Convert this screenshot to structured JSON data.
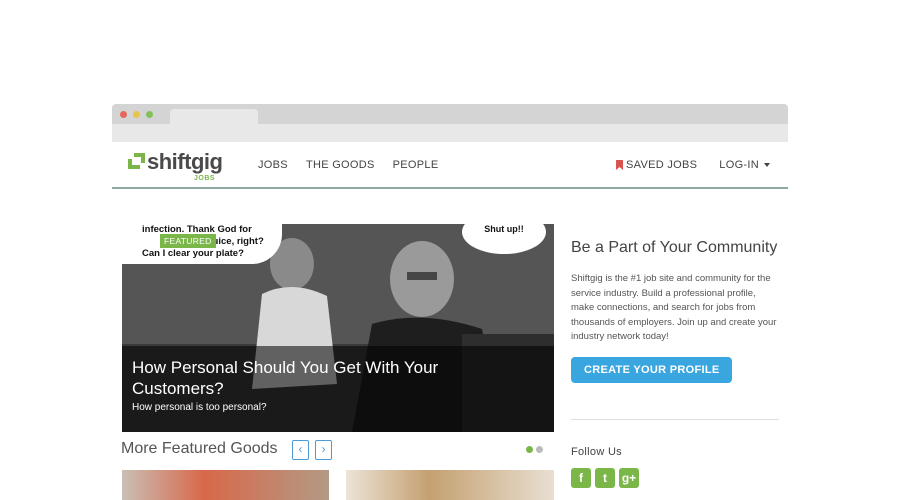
{
  "brand": {
    "name": "shiftgig",
    "subtitle": "JOBS",
    "tm": "™"
  },
  "nav": {
    "items": [
      "JOBS",
      "THE GOODS",
      "PEOPLE"
    ]
  },
  "right_nav": {
    "saved_jobs": "SAVED JOBS",
    "login": "LOG-IN"
  },
  "feature": {
    "badge": "FEATURED",
    "bubble_left": [
      "infection. Thank God for",
      "y juice, right?",
      "Can I clear your plate?"
    ],
    "bubble_right": "Shut up!!",
    "title": "How Personal Should You Get With Your Customers?",
    "subtitle": "How personal is too personal?"
  },
  "more_featured": {
    "title": "More Featured Goods",
    "prev": "‹",
    "next": "›"
  },
  "sidebar": {
    "title": "Be a Part of Your Community",
    "text": "Shiftgig is the #1 job site and community for the service industry. Build a professional profile, make connections, and search for jobs from thousands of employers. Join up and create your industry network today!",
    "cta": "CREATE YOUR PROFILE",
    "follow": "Follow Us",
    "social": [
      {
        "name": "facebook-icon",
        "glyph": "f"
      },
      {
        "name": "twitter-icon",
        "glyph": "t"
      },
      {
        "name": "google-plus-icon",
        "glyph": "g+"
      }
    ]
  },
  "colors": {
    "brand_green": "#7ab648",
    "cta_blue": "#3aa6e0",
    "bookmark_red": "#d9534f"
  }
}
